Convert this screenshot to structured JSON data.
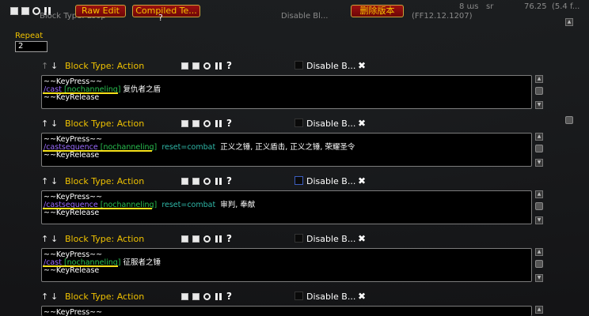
{
  "topbar": {
    "raw_edit_label": "Raw Edit",
    "compiled_label": "Compiled Te...",
    "delete_label": "删除版本",
    "faded_left": "Block Type: Loop",
    "faded_mid": "Disable Bl...",
    "faded_right": "(FF12.12.1207)",
    "faded_far": "8   ɯs   sr",
    "faded_far2": "76.25  (5.4 f..."
  },
  "repeat": {
    "label": "Repeat",
    "value": "2"
  },
  "blocks": [
    {
      "type_label": "Block Type: Action",
      "disable_label": "Disable B...",
      "lines": {
        "kp1": "~~KeyPress~~",
        "cmd": "/cast",
        "mod": "[nochanneling]",
        "comment": "",
        "spell": "复仇者之盾",
        "kp2": "~~KeyRelease"
      }
    },
    {
      "type_label": "Block Type: Action",
      "disable_label": "Disable B...",
      "lines": {
        "kp1": "~~KeyPress~~",
        "cmd": "/castsequence",
        "mod": "[nochanneling]",
        "comment": "reset=combat",
        "spell": "正义之锤, 正义盾击, 正义之锤, 荣耀圣令",
        "kp2": "~~KeyRelease"
      }
    },
    {
      "type_label": "Block Type: Action",
      "disable_label": "Disable B...",
      "lines": {
        "kp1": "~~KeyPress~~",
        "cmd": "/castsequence",
        "mod": "[nochanneling]",
        "comment": "reset=combat",
        "spell": "审判, 奉献",
        "kp2": "~~KeyRelease"
      }
    },
    {
      "type_label": "Block Type: Action",
      "disable_label": "Disable B...",
      "lines": {
        "kp1": "~~KeyPress~~",
        "cmd": "/cast",
        "mod": "[nochanneling]",
        "comment": "",
        "spell": "征服者之锤",
        "kp2": "~~KeyRelease"
      }
    },
    {
      "type_label": "Block Type: Action",
      "disable_label": "Disable B...",
      "lines": {
        "kp1": "~~KeyPress~~",
        "cmd": "",
        "mod": "",
        "comment": "",
        "spell": "",
        "kp2": ""
      }
    }
  ],
  "icons": {
    "save": "save-icon",
    "insert": "insert-icon",
    "circle": "circle-icon",
    "pause": "pause-icon",
    "help": "help-icon",
    "delete": "close-icon",
    "up": "arrow-up-icon",
    "down": "arrow-down-icon"
  },
  "colors": {
    "label_gold": "#f0c200",
    "command_purple": "#9b6bff",
    "modifier_green": "#29c050",
    "comment_teal": "#2fb8a8",
    "underline_yellow": "#f5e11a",
    "button_red": "#8a0c0c"
  }
}
